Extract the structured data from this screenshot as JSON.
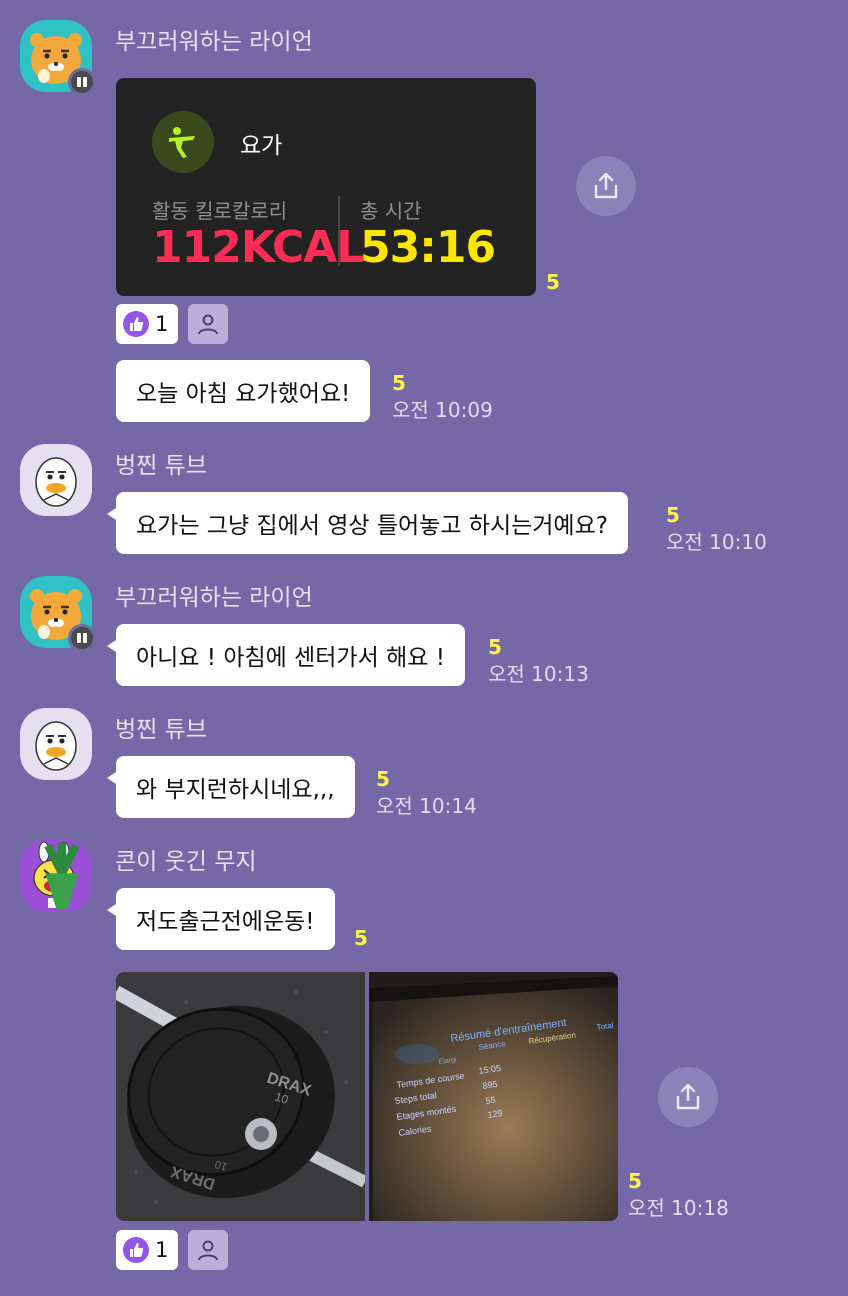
{
  "messages": {
    "m1": {
      "sender": "부끄러워하는 라이언",
      "workout": {
        "activity": "요가",
        "calorie_label": "활동 킬로칼로리",
        "calorie_value": "112KCAL",
        "time_label": "총 시간",
        "time_value": "53:16"
      },
      "unread": "5",
      "reaction_count": "1"
    },
    "m2": {
      "text": "오늘 아침 요가했어요!",
      "unread": "5",
      "time": "오전 10:09"
    },
    "m3": {
      "sender": "벙찐 튜브",
      "text": "요가는 그냥 집에서 영상 틀어놓고 하시는거예요?",
      "unread": "5",
      "time": "오전 10:10"
    },
    "m4": {
      "sender": "부끄러워하는 라이언",
      "text": "아니요 ! 아침에 센터가서 해요 !",
      "unread": "5",
      "time": "오전 10:13"
    },
    "m5": {
      "sender": "벙찐 튜브",
      "text": "와 부지런하시네요,,,",
      "unread": "5",
      "time": "오전 10:14"
    },
    "m6": {
      "sender": "콘이 웃긴 무지",
      "text": "저도출근전에운동!",
      "unread": "5"
    },
    "m7": {
      "photo1": {
        "plate_brand": "DRAX",
        "plate_weight": "10"
      },
      "photo2": {
        "title": "Résumé d'entraînement",
        "cols": [
          "Séance",
          "Récupération",
          "Total"
        ],
        "sub": "Élargi",
        "rows": [
          "Temps de course",
          "Steps total",
          "Etages montés",
          "Calories"
        ],
        "vals": [
          "15:05",
          "895",
          "55",
          "129"
        ]
      },
      "unread": "5",
      "time": "오전 10:18",
      "reaction_count": "1"
    }
  },
  "colors": {
    "background": "#7469a6",
    "unread": "#fff24a",
    "calorie": "#ff2d55",
    "time_value": "#ffe600",
    "yoga_icon": "#b8f22b",
    "reaction": "#9356e8"
  },
  "icons": {
    "share": "share-icon",
    "thumbs_up": "thumbs-up-icon",
    "person": "person-icon",
    "yoga": "yoga-icon"
  }
}
